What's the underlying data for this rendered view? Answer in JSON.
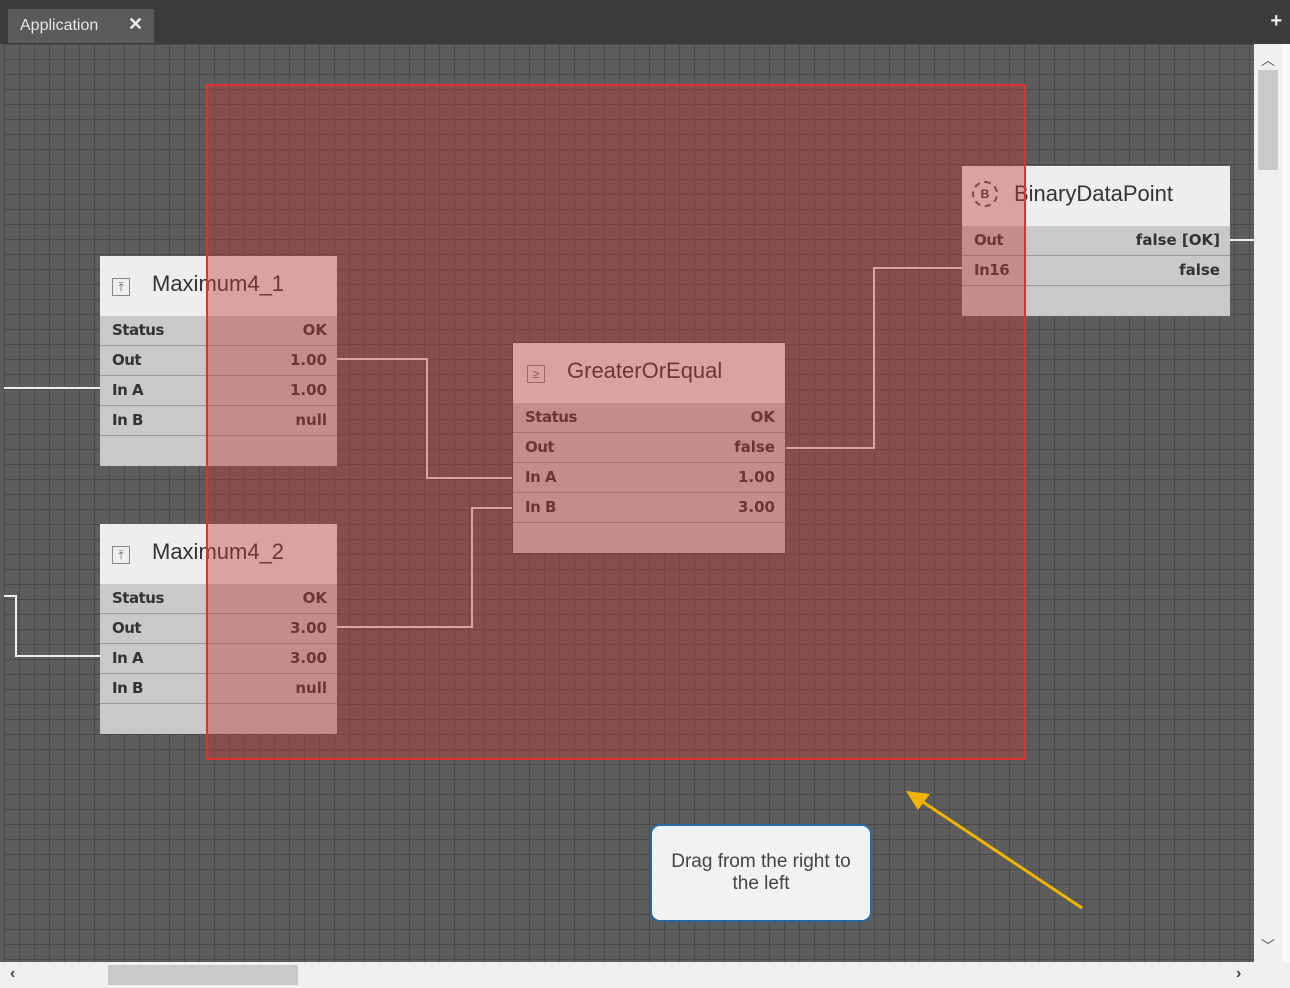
{
  "tab": {
    "label": "Application",
    "close_icon": "close-icon",
    "add_icon": "plus-icon"
  },
  "blocks": {
    "maximum4_1": {
      "title": "Maximum4_1",
      "icon": "maximum-icon",
      "rows": [
        {
          "label": "Status",
          "value": "OK"
        },
        {
          "label": "Out",
          "value": "1.00"
        },
        {
          "label": "In A",
          "value": "1.00"
        },
        {
          "label": "In B",
          "value": "null"
        }
      ]
    },
    "maximum4_2": {
      "title": "Maximum4_2",
      "icon": "maximum-icon",
      "rows": [
        {
          "label": "Status",
          "value": "OK"
        },
        {
          "label": "Out",
          "value": "3.00"
        },
        {
          "label": "In A",
          "value": "3.00"
        },
        {
          "label": "In B",
          "value": "null"
        }
      ]
    },
    "greater_or_equal": {
      "title": "GreaterOrEqual",
      "icon": "greater-or-equal-icon",
      "rows": [
        {
          "label": "Status",
          "value": "OK"
        },
        {
          "label": "Out",
          "value": "false"
        },
        {
          "label": "In A",
          "value": "1.00"
        },
        {
          "label": "In B",
          "value": "3.00"
        }
      ]
    },
    "binary_data_point": {
      "title": "BinaryDataPoint",
      "icon": "binary-datapoint-icon",
      "rows": [
        {
          "label": "Out",
          "value": "false [OK]"
        },
        {
          "label": "In16",
          "value": "false"
        }
      ]
    }
  },
  "callout": {
    "text": "Drag from the right to the left"
  },
  "colors": {
    "selection_border": "#e0312f",
    "arrow": "#f0b400",
    "callout_border": "#2b6a9e"
  }
}
